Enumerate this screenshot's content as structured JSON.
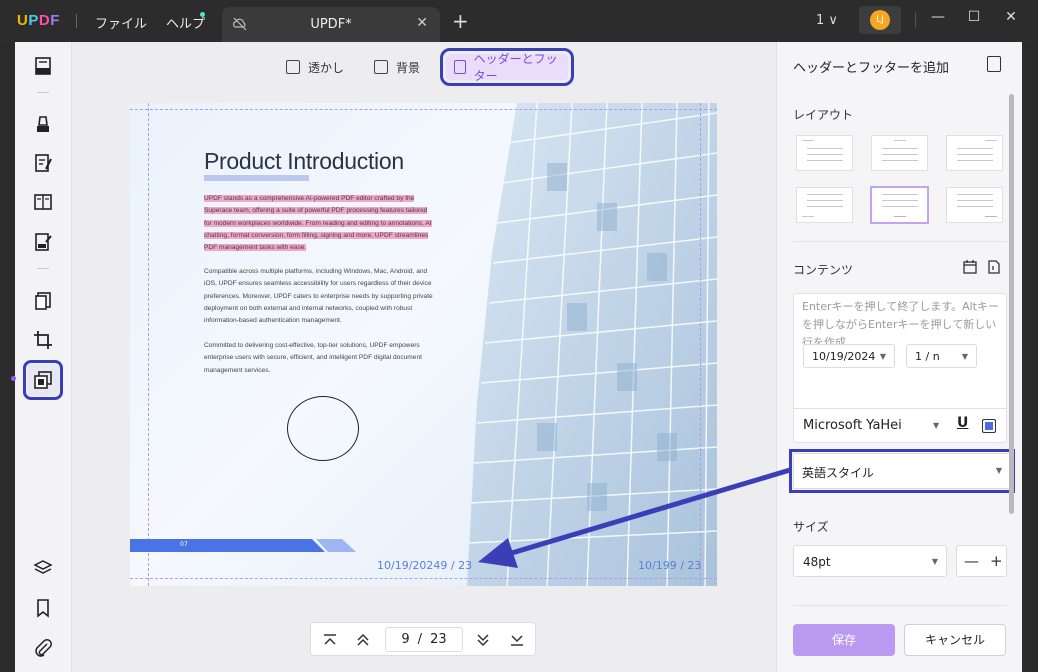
{
  "app": {
    "logo_u": "U",
    "logo_p": "P",
    "logo_d": "D",
    "logo_f": "F"
  },
  "menu": {
    "file": "ファイル",
    "help": "ヘルプ"
  },
  "tab": {
    "title": "UPDF*",
    "close": "✕",
    "new": "+"
  },
  "titlebar": {
    "page_count": "1 ∨",
    "avatar": "LJ",
    "minimize": "—",
    "maximize": "☐",
    "close": "✕"
  },
  "subtabs": {
    "watermark": "透かし",
    "background": "背景",
    "header_footer": "ヘッダーとフッター"
  },
  "document": {
    "title": "Product Introduction",
    "para1": "UPDF stands as a comprehensive AI-powered PDF editor crafted by the Superace team, offering a suite of powerful PDF processing features tailored for modern workplaces worldwide. From reading and editing to annotations, AI chatting, format conversion, form filling, signing and more, UPDF streamlines PDF management tasks with ease.",
    "para2": "Compatible across multiple platforms, including Windows, Mac, Android, and iOS, UPDF ensures seamless accessibility for users regardless of their device preferences. Moreover, UPDF caters to enterprise needs by supporting private deployment on both external and internal networks, coupled with robust information-based authentication management.",
    "para3": "Committed to delivering cost-effective, top-tier solutions, UPDF empowers enterprise users with secure, efficient, and intelligent PDF digital document management services.",
    "page_label": "07",
    "footer_left": "10/19/20249 / 23",
    "footer_right": "10/199 / 23"
  },
  "pagenav": {
    "current": "9",
    "separator": "/",
    "total": "23"
  },
  "panel": {
    "title": "ヘッダーとフッターを追加",
    "layout_label": "レイアウト",
    "content_label": "コンテンツ",
    "content_placeholder": "Enterキーを押して終了します。Altキーを押しながらEnterキーを押して新しい行を作成",
    "date_value": "10/19/2024",
    "page_format": "1 / n",
    "font": "Microsoft YaHei",
    "underline": "U",
    "style_value": "英語スタイル",
    "size_label": "サイズ",
    "size_value": "48pt",
    "minus": "—",
    "plus": "+",
    "save": "保存",
    "cancel": "キャンセル"
  },
  "colors": {
    "accent": "#3a3fb8",
    "highlight": "#f2a7c9",
    "save": "#b99af0"
  }
}
